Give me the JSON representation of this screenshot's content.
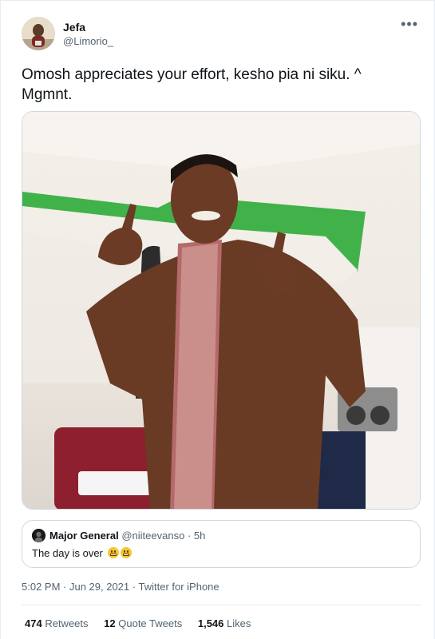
{
  "user": {
    "display_name": "Jefa",
    "handle": "@Limorio_",
    "avatar_icon": "profile-photo"
  },
  "more_icon": "more-icon",
  "tweet": {
    "text": "Omosh appreciates your effort, kesho pia ni siku. ^ Mgmnt."
  },
  "quoted_tweet": {
    "display_name": "Major General",
    "handle": "@niiteevanso",
    "separator": "·",
    "time": "5h",
    "text": "The day is over",
    "emojis": [
      "grimacing-face-emoji",
      "grimacing-face-emoji"
    ]
  },
  "meta": {
    "timestamp": "5:02 PM · Jun 29, 2021",
    "separator": " · ",
    "source": "Twitter for iPhone"
  },
  "stats": {
    "retweets": {
      "count": "474",
      "label": "Retweets"
    },
    "quote_tweets": {
      "count": "12",
      "label": "Quote Tweets"
    },
    "likes": {
      "count": "1,546",
      "label": "Likes"
    }
  },
  "colors": {
    "text_primary": "#0f1419",
    "text_secondary": "#536471",
    "border": "#cfd9de"
  }
}
